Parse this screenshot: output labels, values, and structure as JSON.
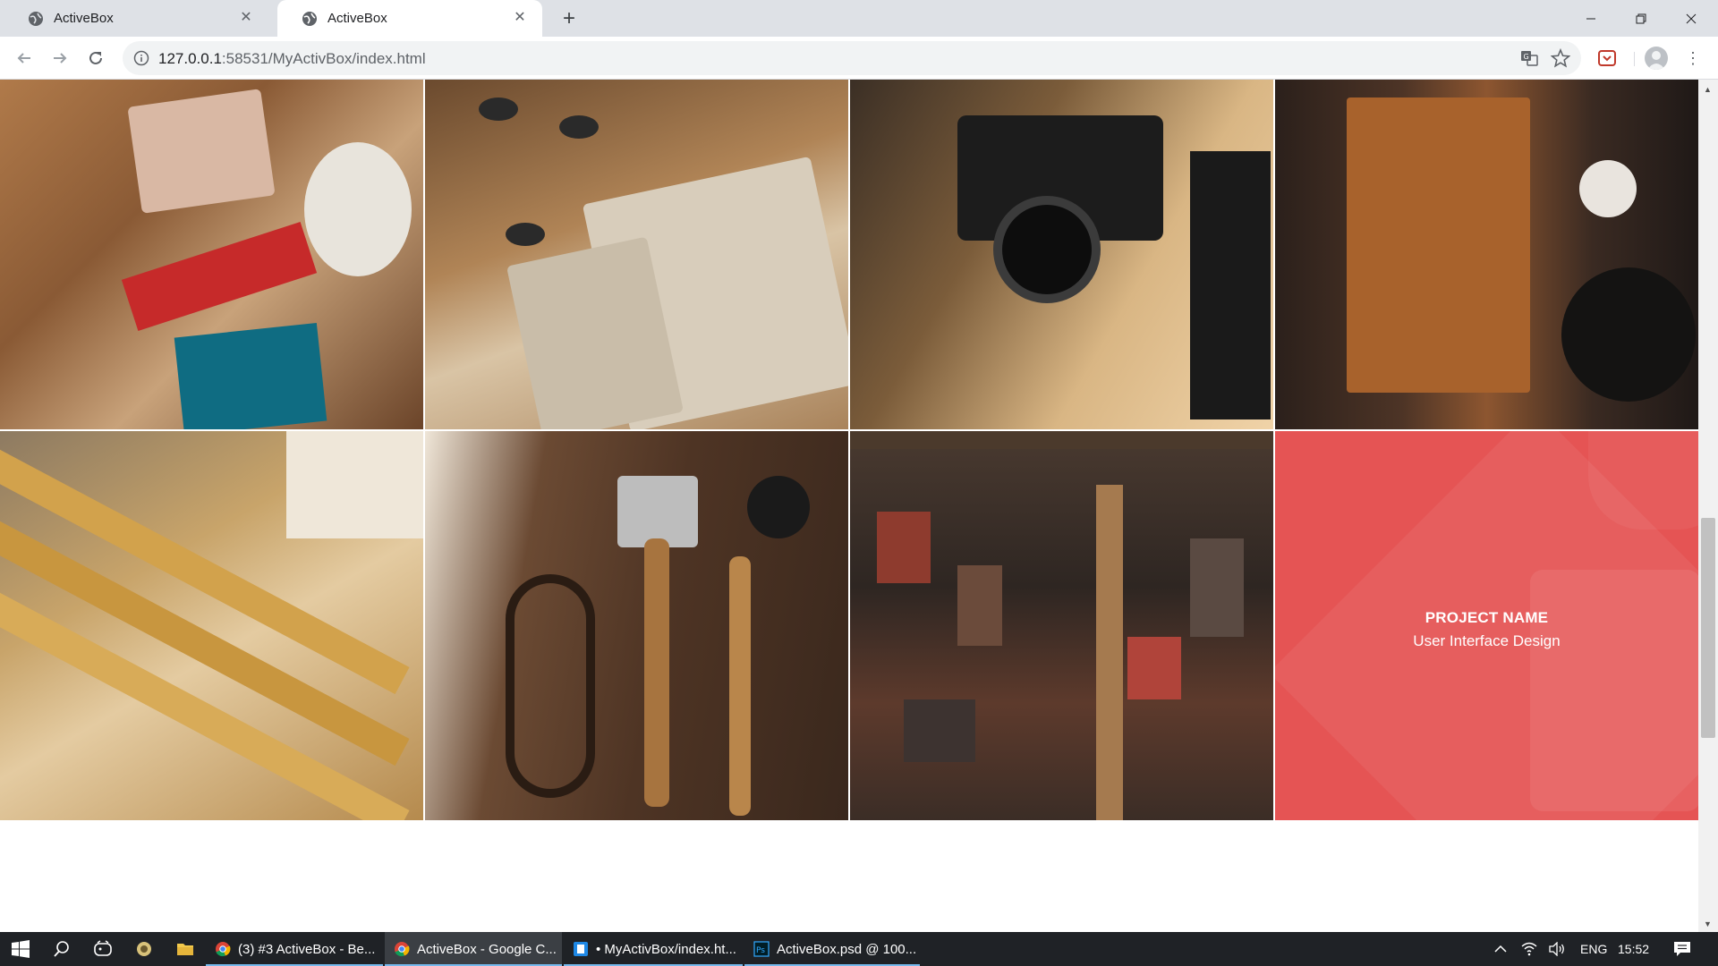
{
  "browser": {
    "tabs": [
      {
        "title": "ActiveBox",
        "active": false
      },
      {
        "title": "ActiveBox",
        "active": true
      }
    ],
    "new_tab_label": "+",
    "window_controls": {
      "minimize": "—",
      "maximize": "❐",
      "close": "✕"
    },
    "address": {
      "host": "127.0.0.1",
      "rest": ":58531/MyActivBox/index.html"
    },
    "menu_glyph": "⋮"
  },
  "portfolio": {
    "tiles": [
      {
        "subject": "vintage collection flat-lay"
      },
      {
        "subject": "notebooks"
      },
      {
        "subject": "cameras"
      },
      {
        "subject": "cutting board"
      },
      {
        "subject": "folding rulers"
      },
      {
        "subject": "old tools"
      },
      {
        "subject": "letterpress type"
      },
      {
        "subject": "hovered project"
      }
    ],
    "hover_overlay": {
      "title": "PROJECT NAME",
      "subtitle": "User Interface Design",
      "color": "#e55454"
    }
  },
  "taskbar": {
    "apps": [
      {
        "label": "(3) #3 ActiveBox - Be...",
        "icon": "chrome-icon"
      },
      {
        "label": "ActiveBox - Google C...",
        "icon": "chrome-icon"
      },
      {
        "label": "• MyActivBox/index.ht...",
        "icon": "editor-icon"
      },
      {
        "label": "ActiveBox.psd @ 100...",
        "icon": "photoshop-icon"
      }
    ],
    "tray": {
      "language": "ENG",
      "time": "15:52"
    }
  },
  "scroll_arrows": {
    "up": "▲",
    "down": "▼"
  }
}
